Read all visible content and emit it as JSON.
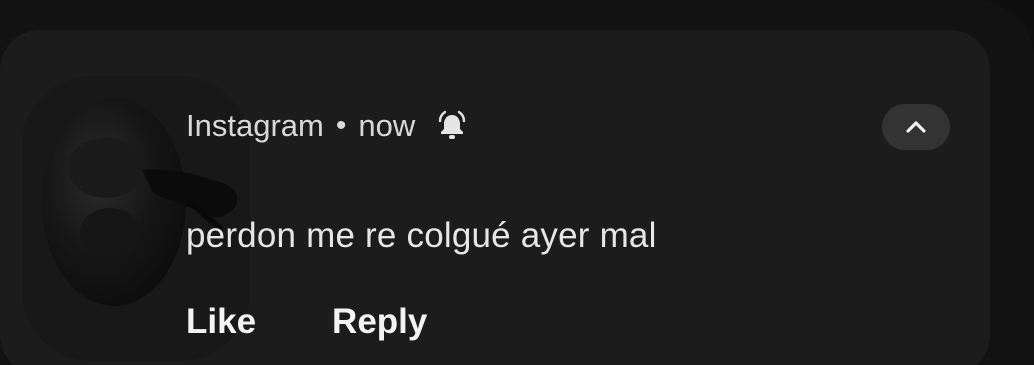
{
  "notification": {
    "app_name": "Instagram",
    "separator": "•",
    "time": "now",
    "message": "perdon me re colgué ayer mal",
    "actions": {
      "like": "Like",
      "reply": "Reply"
    },
    "icons": {
      "alert": "bell-ringing-icon",
      "collapse": "chevron-up-icon"
    }
  },
  "colors": {
    "background": "#111111",
    "card": "#1c1c1c",
    "button": "#333333",
    "text_primary": "#e6e6e6",
    "text_secondary": "#d9d9d9"
  }
}
